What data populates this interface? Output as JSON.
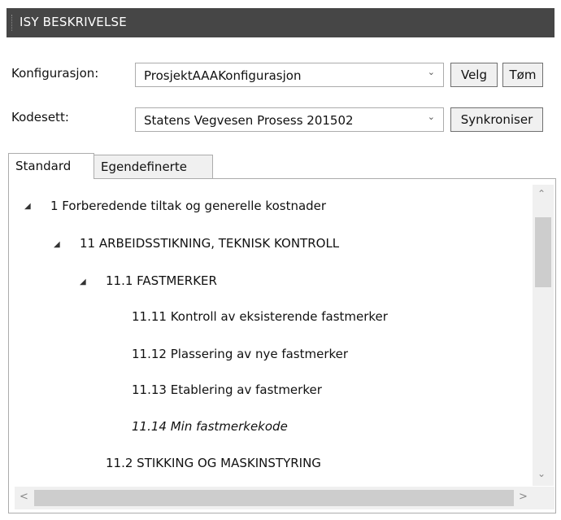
{
  "window": {
    "title": "ISY BESKRIVELSE"
  },
  "config": {
    "label": "Konfigurasjon:",
    "value": "ProsjektAAAKonfigurasjon",
    "select_button": "Velg",
    "clear_button": "Tøm"
  },
  "codeset": {
    "label": "Kodesett:",
    "value": "Statens Vegvesen Prosess 201502",
    "sync_button": "Synkroniser"
  },
  "tabs": [
    {
      "label": "Standard",
      "active": true
    },
    {
      "label": "Egendefinerte",
      "active": false
    }
  ],
  "tree": [
    {
      "label": "1 Forberedende tiltak og generelle kostnader",
      "expanded": true,
      "level": 0
    },
    {
      "label": "11 ARBEIDSSTIKNING, TEKNISK KONTROLL",
      "expanded": true,
      "level": 1
    },
    {
      "label": "11.1 FASTMERKER",
      "expanded": true,
      "level": 2
    },
    {
      "label": "11.11 Kontroll av eksisterende fastmerker",
      "level": 3
    },
    {
      "label": "11.12 Plassering av nye fastmerker",
      "level": 3
    },
    {
      "label": "11.13 Etablering av fastmerker",
      "level": 3
    },
    {
      "label": "11.14 Min fastmerkekode",
      "level": 3,
      "custom": true
    },
    {
      "label": "11.2 STIKKING OG MASKINSTYRING",
      "level": 2
    }
  ]
}
